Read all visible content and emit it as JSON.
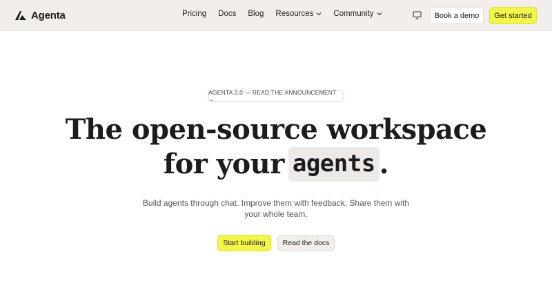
{
  "brand": {
    "name": "Agenta",
    "icon": "agenta-logo-icon"
  },
  "nav": {
    "links": [
      {
        "label": "Pricing"
      },
      {
        "label": "Docs"
      },
      {
        "label": "Blog"
      },
      {
        "label": "Resources",
        "icon": "chevron-down-icon"
      },
      {
        "label": "Community",
        "icon": "chevron-down-icon"
      }
    ],
    "monitor_icon": "monitor-icon",
    "demo_label": "Book a demo",
    "start_label": "Get started"
  },
  "hero": {
    "announcement": "AGENTA 2.0 — READ THE ANNOUNCEMENT →",
    "headline_line1": "The open-source workspace",
    "headline_line2_prefix": "for your",
    "headline_highlight": "agents",
    "headline_suffix": ".",
    "subtitle": "Build agents through chat. Improve them with feedback. Share them with your whole team.",
    "cta_primary": "Start building",
    "cta_secondary": "Read the docs"
  },
  "colors": {
    "nav_bg": "#f1eeeb",
    "accent_yellow": "#f2f54a",
    "chip_bg": "#ece9e6",
    "text": "#1c1c1c"
  }
}
